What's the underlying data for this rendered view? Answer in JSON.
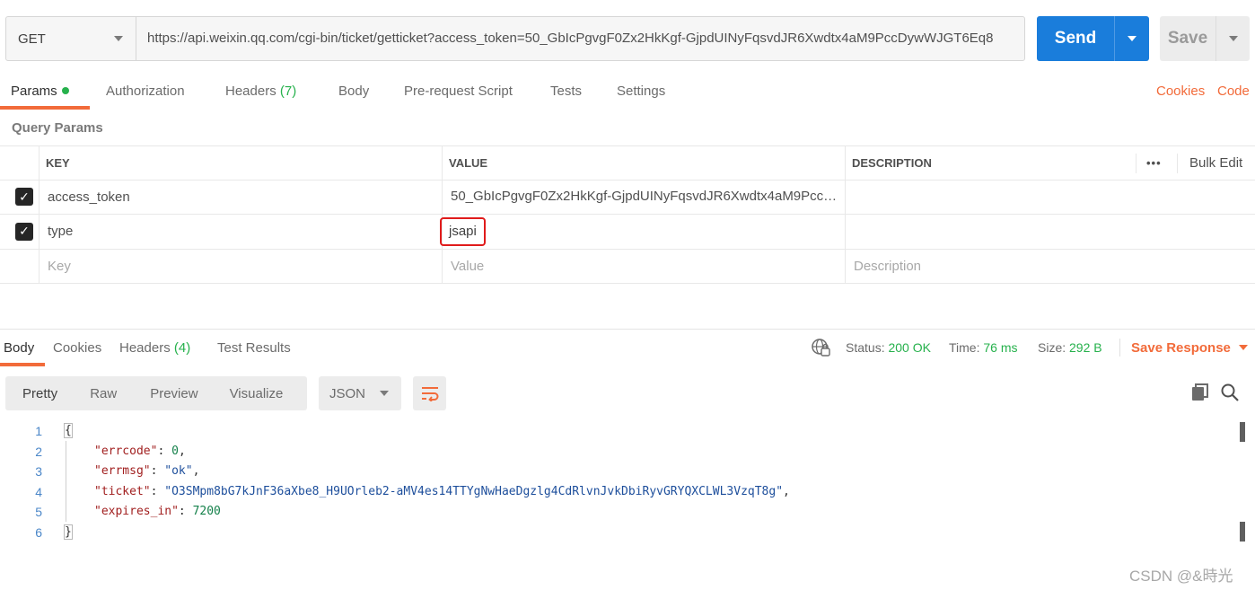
{
  "request": {
    "method": "GET",
    "url": "https://api.weixin.qq.com/cgi-bin/ticket/getticket?access_token=50_GbIcPgvgF0Zx2HkKgf-GjpdUINyFqsvdJR6Xwdtx4aM9PccDywWJGT6Eq8",
    "send_label": "Send",
    "save_label": "Save"
  },
  "tabs": {
    "params": "Params",
    "authorization": "Authorization",
    "headers": "Headers",
    "headers_count": "(7)",
    "body": "Body",
    "prerequest": "Pre-request Script",
    "tests": "Tests",
    "settings": "Settings",
    "cookies": "Cookies",
    "code": "Code"
  },
  "query_params": {
    "title": "Query Params",
    "columns": {
      "key": "KEY",
      "value": "VALUE",
      "description": "DESCRIPTION"
    },
    "bulk_edit": "Bulk Edit",
    "rows": [
      {
        "key": "access_token",
        "value": "50_GbIcPgvgF0Zx2HkKgf-GjpdUINyFqsvdJR6Xwdtx4aM9PccD...",
        "description": ""
      },
      {
        "key": "type",
        "value": "jsapi",
        "description": ""
      }
    ],
    "placeholders": {
      "key": "Key",
      "value": "Value",
      "description": "Description"
    }
  },
  "response": {
    "tabs": {
      "body": "Body",
      "cookies": "Cookies",
      "headers": "Headers",
      "headers_count": "(4)",
      "test_results": "Test Results"
    },
    "status_label": "Status:",
    "status_value": "200 OK",
    "time_label": "Time:",
    "time_value": "76 ms",
    "size_label": "Size:",
    "size_value": "292 B",
    "save_response": "Save Response",
    "views": [
      "Pretty",
      "Raw",
      "Preview",
      "Visualize"
    ],
    "format": "JSON",
    "line_numbers": [
      "1",
      "2",
      "3",
      "4",
      "5",
      "6"
    ],
    "json": {
      "open": "{",
      "close": "}",
      "errcode_key": "\"errcode\"",
      "errcode_val": "0",
      "errmsg_key": "\"errmsg\"",
      "errmsg_val": "\"ok\"",
      "ticket_key": "\"ticket\"",
      "ticket_val": "\"O3SMpm8bG7kJnF36aXbe8_H9UOrleb2-aMV4es14TTYgNwHaeDgzlg4CdRlvnJvkDbiRyvGRYQXCLWL3VzqT8g\"",
      "expires_key": "\"expires_in\"",
      "expires_val": "7200"
    }
  },
  "watermark": "CSDN @&時光",
  "colors": {
    "accent": "#f26b3a",
    "send_blue": "#1a7ddb",
    "success_green": "#26b14c",
    "highlight_red": "#e01b1b"
  }
}
